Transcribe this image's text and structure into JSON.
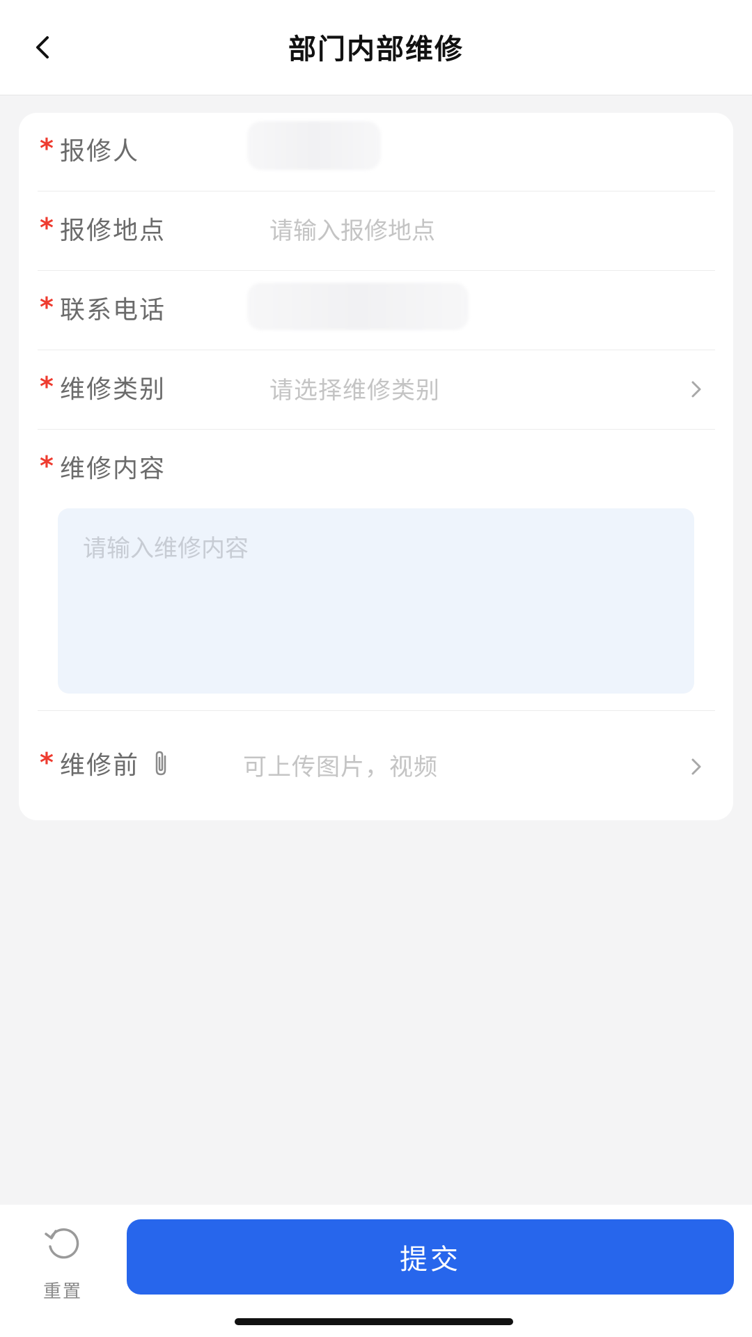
{
  "header": {
    "title": "部门内部维修",
    "back_icon": "chevron-left-icon"
  },
  "form": {
    "required_mark": "*",
    "reporter": {
      "label": "报修人",
      "value": ""
    },
    "location": {
      "label": "报修地点",
      "placeholder": "请输入报修地点",
      "value": ""
    },
    "phone": {
      "label": "联系电话",
      "value": ""
    },
    "category": {
      "label": "维修类别",
      "placeholder": "请选择维修类别",
      "icon": "chevron-right-icon"
    },
    "content": {
      "label": "维修内容",
      "placeholder": "请输入维修内容",
      "value": ""
    },
    "before": {
      "label": "维修前",
      "icon": "paperclip-icon",
      "hint": "可上传图片，视频",
      "chevron_icon": "chevron-right-icon"
    }
  },
  "footer": {
    "reset_label": "重置",
    "reset_icon": "reset-icon",
    "submit_label": "提交"
  },
  "colors": {
    "accent": "#2766ec",
    "required": "#ee3b2f",
    "textarea_bg": "#eef4fc",
    "page_bg": "#f4f4f5"
  }
}
